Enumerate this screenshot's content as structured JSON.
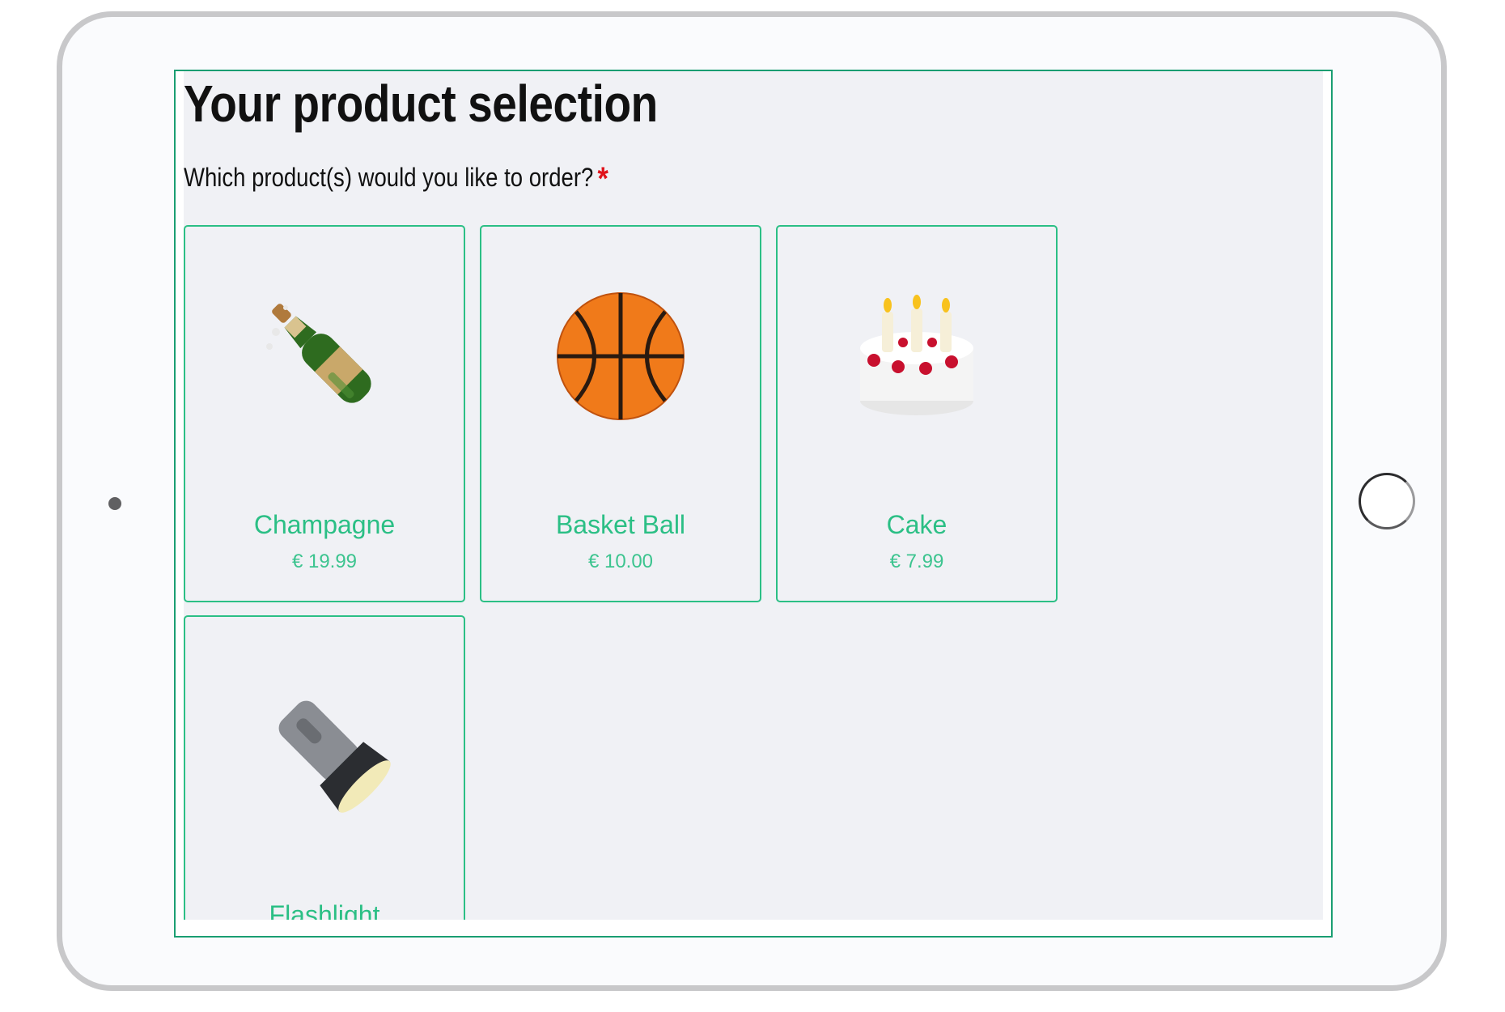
{
  "form": {
    "title": "Your product selection",
    "question": "Which product(s) would you like to order?",
    "required_mark": "*"
  },
  "products": [
    {
      "name": "Champagne",
      "price": "€ 19.99",
      "icon": "champagne-bottle-icon"
    },
    {
      "name": "Basket Ball",
      "price": "€ 10.00",
      "icon": "basketball-icon"
    },
    {
      "name": "Cake",
      "price": "€ 7.99",
      "icon": "birthday-cake-icon"
    },
    {
      "name": "Flashlight",
      "price": "",
      "icon": "flashlight-icon"
    }
  ],
  "colors": {
    "accent": "#2bbf85",
    "border": "#1a9e72",
    "required": "#e0131b",
    "background": "#f0f1f5"
  }
}
